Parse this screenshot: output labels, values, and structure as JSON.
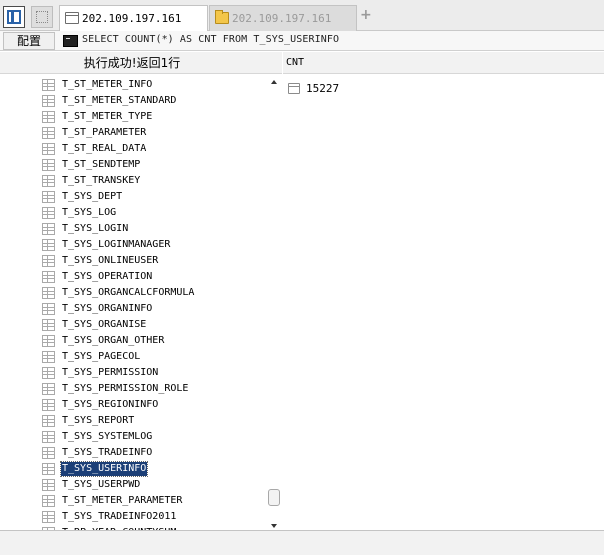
{
  "tabs": [
    {
      "label": "202.109.197.161",
      "icon": "document-icon",
      "active": true
    },
    {
      "label": "202.109.197.161",
      "icon": "folder-icon",
      "active": false
    }
  ],
  "tab_add_label": "+",
  "toolbar": {
    "config_label": "配置",
    "sql": "SELECT COUNT(*) AS CNT FROM T_SYS_USERINFO"
  },
  "left_panel": {
    "header": "执行成功!返回1行",
    "tables": [
      "T_ST_METER_INFO",
      "T_ST_METER_STANDARD",
      "T_ST_METER_TYPE",
      "T_ST_PARAMETER",
      "T_ST_REAL_DATA",
      "T_ST_SENDTEMP",
      "T_ST_TRANSKEY",
      "T_SYS_DEPT",
      "T_SYS_LOG",
      "T_SYS_LOGIN",
      "T_SYS_LOGINMANAGER",
      "T_SYS_ONLINEUSER",
      "T_SYS_OPERATION",
      "T_SYS_ORGANCALCFORMULA",
      "T_SYS_ORGANINFO",
      "T_SYS_ORGANISE",
      "T_SYS_ORGAN_OTHER",
      "T_SYS_PAGECOL",
      "T_SYS_PERMISSION",
      "T_SYS_PERMISSION_ROLE",
      "T_SYS_REGIONINFO",
      "T_SYS_REPORT",
      "T_SYS_SYSTEMLOG",
      "T_SYS_TRADEINFO",
      "T_SYS_USERINFO",
      "T_SYS_USERPWD",
      "T_ST_METER_PARAMETER",
      "T_SYS_TRADEINFO2011",
      "T_RP_YEAR_COUNTYSUM"
    ],
    "selected": "T_SYS_USERINFO"
  },
  "result": {
    "column": "CNT",
    "value": "15227"
  }
}
